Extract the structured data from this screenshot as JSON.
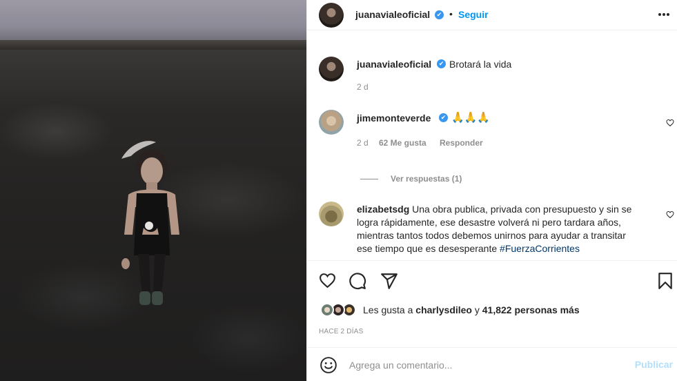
{
  "post": {
    "author": "juanavialeoficial",
    "follow_label": "Seguir",
    "separator": "•"
  },
  "caption": {
    "username": "juanavialeoficial",
    "text": "Brotará la vida",
    "time": "2 d"
  },
  "comments": [
    {
      "username": "jimemonteverde",
      "text": "🙏🙏🙏",
      "time": "2 d",
      "likes": "62 Me gusta",
      "reply_label": "Responder",
      "view_replies": "Ver respuestas (1)"
    },
    {
      "username": "elizabetsdg",
      "lines": [
        "Una obra publica, privada con presupuesto y sin se",
        "logra rápidamente, ese desastre volverá ni pero tardara años,",
        "mientras tantos todos debemos unirnos para ayudar a transitar",
        "ese tiempo que es desesperante"
      ],
      "hashtag": "#FuerzaCorrientes"
    }
  ],
  "likes": {
    "prefix": "Les gusta a",
    "user": "charlysdileo",
    "connector": "y",
    "count": "41,822 personas más"
  },
  "time_ago": "HACE 2 DÍAS",
  "comment_box": {
    "placeholder": "Agrega un comentario...",
    "publish_label": "Publicar"
  },
  "colors": {
    "accent": "#0095f6",
    "verified": "#3897f0",
    "publish_disabled": "#b2dffc",
    "hashtag": "#00376b"
  },
  "icons": [
    "verified-icon",
    "more-options-icon",
    "heart-icon",
    "comment-icon",
    "share-icon",
    "save-icon",
    "emoji-icon"
  ]
}
